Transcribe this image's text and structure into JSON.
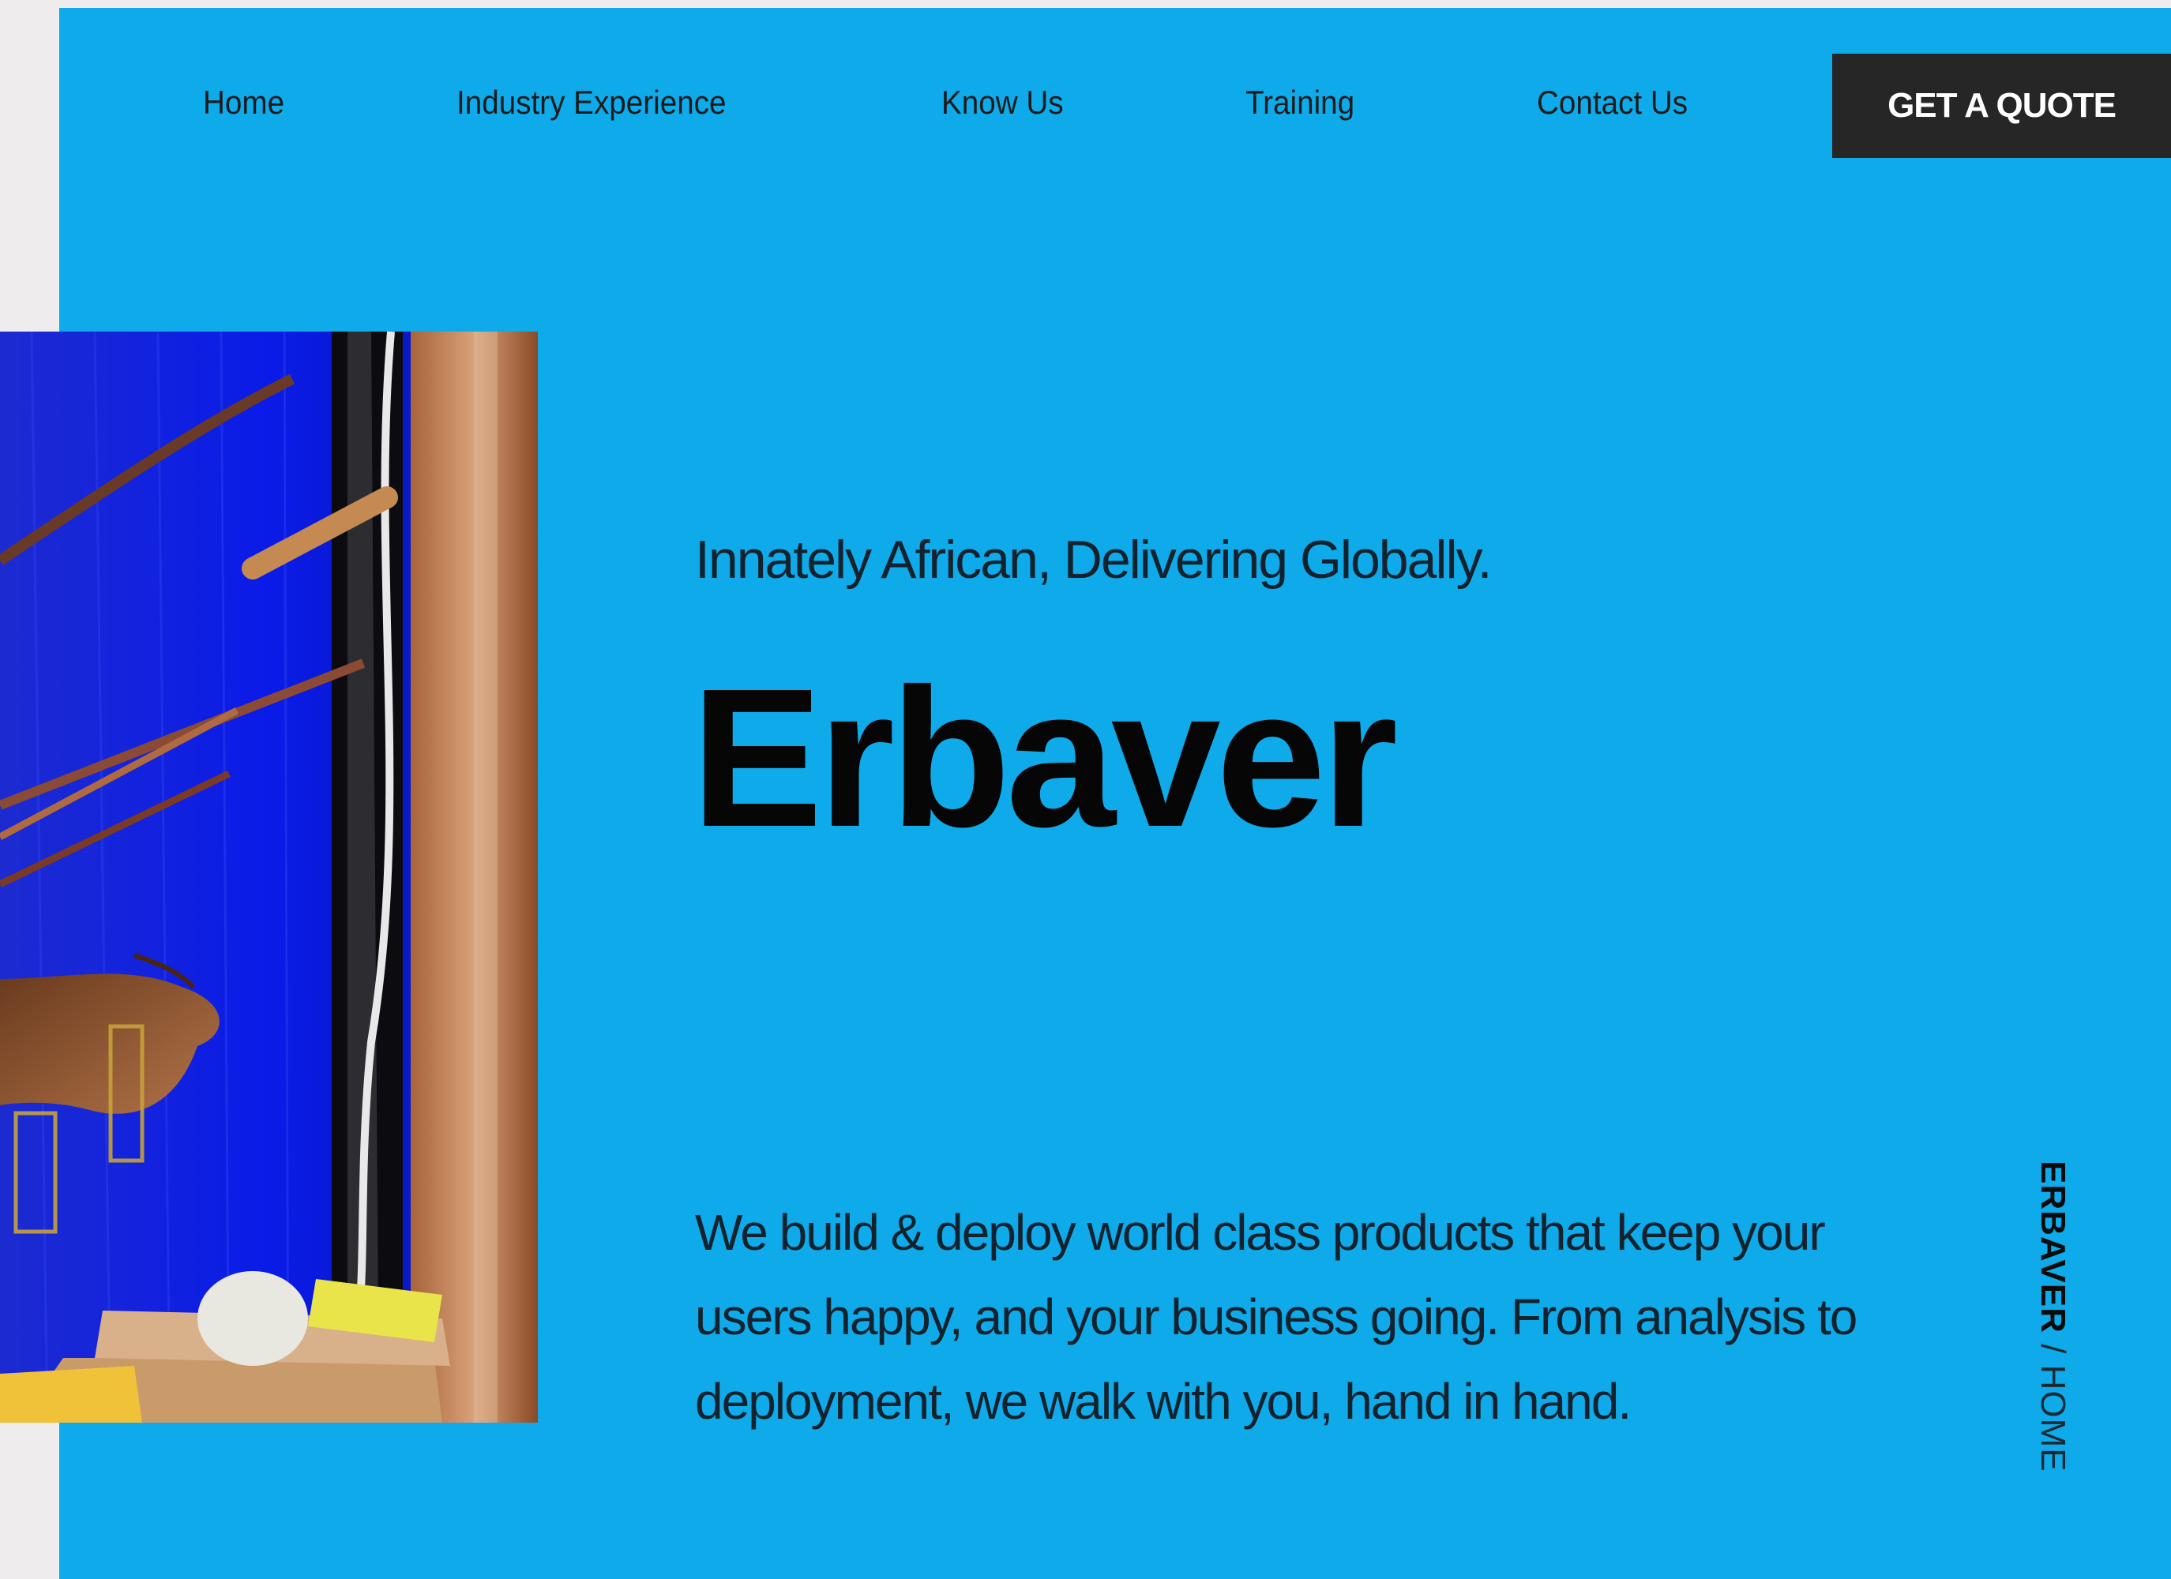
{
  "nav": {
    "items": [
      {
        "label": "Home"
      },
      {
        "label": "Industry Experience"
      },
      {
        "label": "Know Us"
      },
      {
        "label": "Training"
      },
      {
        "label": "Contact Us"
      }
    ],
    "cta_label": "GET A QUOTE"
  },
  "hero": {
    "tagline": "Innately African, Delivering Globally.",
    "brand": "Erbaver",
    "description": "We build & deploy world class products that keep your users happy, and your business going. From analysis to deployment, we walk with you, hand in hand.",
    "image_alt": "Weaver's hands working a loom with blue threads",
    "breadcrumb": {
      "brand": "ERBAVER",
      "separator": " / ",
      "page": "HOME"
    }
  },
  "colors": {
    "hero_bg": "#0eaaea",
    "page_bg": "#efeced",
    "cta_bg": "#262626",
    "cta_text": "#ffffff"
  }
}
